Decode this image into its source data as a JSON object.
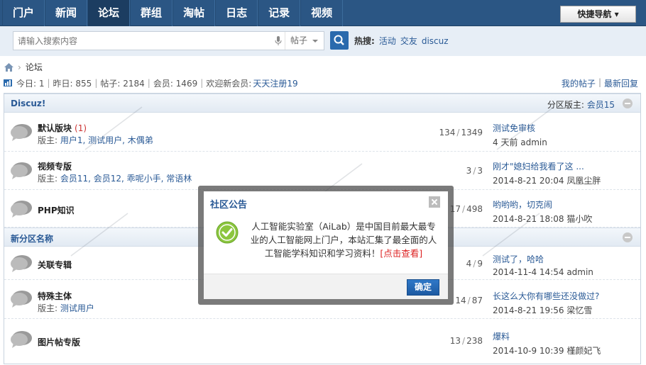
{
  "nav": {
    "items": [
      {
        "label": "门户"
      },
      {
        "label": "新闻"
      },
      {
        "label": "论坛"
      },
      {
        "label": "群组"
      },
      {
        "label": "淘帖"
      },
      {
        "label": "日志"
      },
      {
        "label": "记录"
      },
      {
        "label": "视频"
      }
    ],
    "active_index": 2,
    "quick_nav": "快捷导航 ▾"
  },
  "search": {
    "placeholder": "请输入搜索内容",
    "type": "帖子",
    "hot_label": "热搜:",
    "hot_words": [
      "活动",
      "交友",
      "discuz"
    ]
  },
  "breadcrumb": {
    "current": "论坛"
  },
  "stats": {
    "today": "今日: 1",
    "yesterday": "昨日: 855",
    "posts": "帖子: 2184",
    "members": "会员: 1469",
    "welcome": "欢迎新会员:",
    "new_member": "天天注册19",
    "my_posts": "我的帖子",
    "latest_reply": "最新回复"
  },
  "categories": [
    {
      "title": "Discuz!",
      "moderator_label": "分区版主:",
      "moderator": "会员15",
      "forums": [
        {
          "name": "默认版块",
          "today": "(1)",
          "mods_label": "版主:",
          "mods": "用户1, 测试用户, 木偶弟",
          "threads": "134",
          "posts": "1349",
          "last_title": "测试免审核",
          "last_meta": "4 天前 admin"
        },
        {
          "name": "视频专版",
          "today": "",
          "mods_label": "版主:",
          "mods": "会员11, 会员12, 乖呢小手, 常语林",
          "threads": "3",
          "posts": "3",
          "last_title": "刚才\"媳妇给我看了这 ...",
          "last_meta": "2014-8-21 20:04 凤凰尘胖"
        },
        {
          "name": "PHP知识",
          "today": "",
          "mods_label": "",
          "mods": "",
          "threads": "17",
          "posts": "498",
          "last_title": "哟哟哟，切克闹",
          "last_meta": "2014-8-21 18:08 猫小吹"
        }
      ]
    },
    {
      "title": "新分区名称",
      "moderator_label": "",
      "moderator": "",
      "forums": [
        {
          "name": "关联专辑",
          "today": "",
          "mods_label": "",
          "mods": "",
          "threads": "4",
          "posts": "9",
          "last_title": "测试了，哈哈",
          "last_meta": "2014-11-4 14:54 admin"
        },
        {
          "name": "特殊主体",
          "today": "",
          "mods_label": "版主:",
          "mods": "测试用户",
          "threads": "14",
          "posts": "87",
          "last_title": "长这么大你有哪些还没做过?",
          "last_meta": "2014-8-21 19:56 梁忆雪"
        },
        {
          "name": "图片帖专版",
          "today": "",
          "mods_label": "",
          "mods": "",
          "threads": "13",
          "posts": "238",
          "last_title": "爆料",
          "last_meta": "2014-10-9 10:39 槿颜妃飞"
        }
      ]
    }
  ],
  "modal": {
    "title": "社区公告",
    "message": "人工智能实验室（AiLab）是中国目前最大最专业的人工智能网上门户，本站汇集了最全面的人工智能学科知识和学习资料！",
    "link": "[点击查看]",
    "ok": "确定"
  },
  "colors": {
    "nav_bg": "#2b5684",
    "link": "#2a5a96",
    "accent_red": "#d22",
    "ok_button": "#2f78c8"
  }
}
